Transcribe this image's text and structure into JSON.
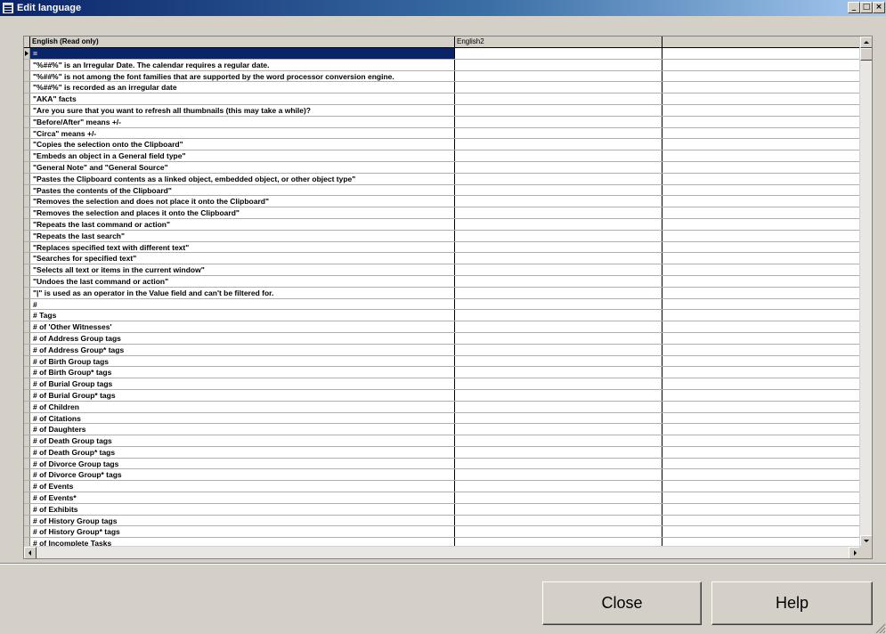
{
  "window": {
    "title": "Edit language",
    "minimize_glyph": "_",
    "maximize_glyph": "□",
    "close_glyph": "×"
  },
  "grid": {
    "columns": [
      "English (Read only)",
      "English2",
      ""
    ],
    "rows": [
      "=",
      "\"%##%\" is an Irregular Date. The calendar requires a regular date.",
      "\"%##%\" is not among the font families that are supported by the word processor conversion engine.",
      "\"%##%\" is recorded as an irregular date",
      "\"AKA\" facts",
      "\"Are you sure that you want to refresh all thumbnails (this may take a while)?",
      "\"Before/After\" means +/-",
      "\"Circa\" means +/-",
      "\"Copies the selection onto the Clipboard\"",
      "\"Embeds an object in a General field type\"",
      "\"General Note\" and \"General Source\"",
      "\"Pastes the Clipboard contents as a linked object, embedded object, or other object type\"",
      "\"Pastes the contents of the Clipboard\"",
      "\"Removes the selection and does not place it onto the Clipboard\"",
      "\"Removes the selection and places it onto the Clipboard\"",
      "\"Repeats the last command or action\"",
      "\"Repeats the last search\"",
      "\"Replaces specified text with different text\"",
      "\"Searches for specified text\"",
      "\"Selects all text or items in the current window\"",
      "\"Undoes the last command or action\"",
      "\"|\" is used as an operator in the Value field and can't be filtered for.",
      "#",
      "# Tags",
      "# of 'Other Witnesses'",
      "# of Address Group tags",
      "# of Address Group* tags",
      "# of Birth Group tags",
      "# of Birth Group* tags",
      "# of Burial Group tags",
      "# of Burial Group* tags",
      "# of Children",
      "# of Citations",
      "# of Daughters",
      "# of Death Group tags",
      "# of Death Group* tags",
      "# of Divorce Group tags",
      "# of Divorce Group* tags",
      "# of Events",
      "# of Events*",
      "# of Exhibits",
      "# of History Group tags",
      "# of History Group* tags",
      "# of Incomplete Tasks"
    ]
  },
  "buttons": {
    "close": "Close",
    "help": "Help"
  }
}
